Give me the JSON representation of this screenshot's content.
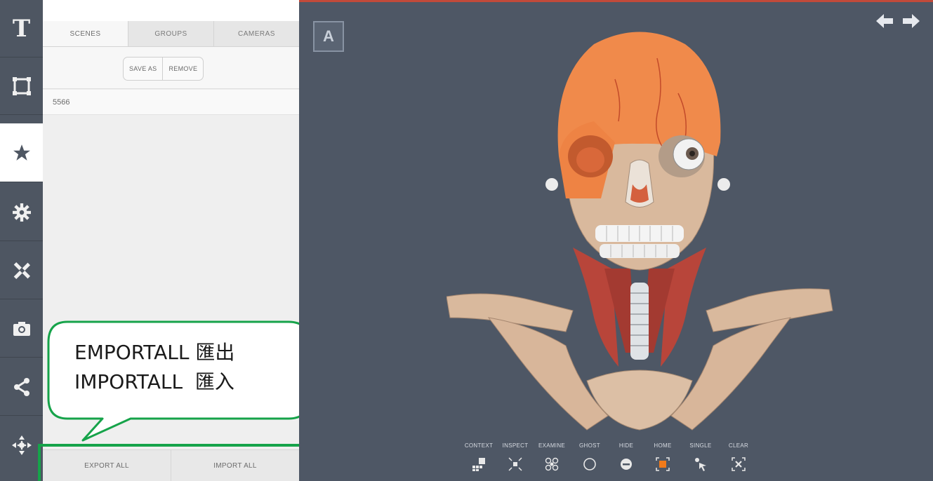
{
  "rail": {
    "items": [
      {
        "name": "text",
        "glyph": "T"
      },
      {
        "name": "frame"
      },
      {
        "name": "scenes"
      },
      {
        "name": "settings"
      },
      {
        "name": "tools"
      },
      {
        "name": "camera"
      },
      {
        "name": "share"
      },
      {
        "name": "move"
      }
    ],
    "active_index": 2
  },
  "panel": {
    "tabs": [
      "SCENES",
      "GROUPS",
      "CAMERAS"
    ],
    "active_tab": "SCENES",
    "save_as_label": "SAVE AS",
    "remove_label": "REMOVE",
    "scenes": [
      "5566"
    ],
    "export_all_label": "EXPORT ALL",
    "import_all_label": "IMPORT ALL"
  },
  "annotation": {
    "line1": "EMPORTALL 匯出",
    "line2": "IMPORTALL  匯入",
    "highlight_color": "#16a34a"
  },
  "viewport": {
    "a_button": "A",
    "toolbar": [
      {
        "label": "CONTEXT",
        "icon": "context-icon"
      },
      {
        "label": "INSPECT",
        "icon": "inspect-icon"
      },
      {
        "label": "EXAMINE",
        "icon": "examine-icon"
      },
      {
        "label": "GHOST",
        "icon": "ghost-icon"
      },
      {
        "label": "HIDE",
        "icon": "hide-icon"
      },
      {
        "label": "HOME",
        "icon": "home-icon"
      },
      {
        "label": "SINGLE",
        "icon": "single-icon"
      },
      {
        "label": "CLEAR",
        "icon": "clear-icon"
      }
    ],
    "colors": {
      "background": "#4e5765",
      "skull_highlight": "#f08a4b",
      "bone": "#d9b99d",
      "muscle": "#b8453a",
      "home_accent": "#f07a1a"
    }
  }
}
